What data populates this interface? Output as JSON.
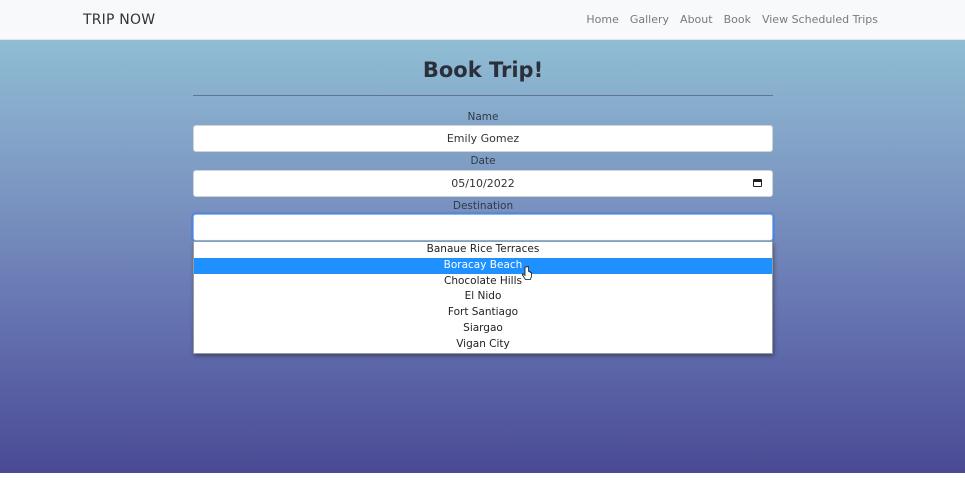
{
  "navbar": {
    "brand": "TRIP NOW",
    "links": [
      "Home",
      "Gallery",
      "About",
      "Book",
      "View Scheduled Trips"
    ]
  },
  "form": {
    "title": "Book Trip!",
    "name_label": "Name",
    "name_value": "Emily Gomez",
    "date_label": "Date",
    "date_value": "05/10/2022",
    "destination_label": "Destination",
    "destination_value": "",
    "destination_options": [
      "Banaue Rice Terraces",
      "Boracay Beach",
      "Chocolate Hills",
      "El Nido",
      "Fort Santiago",
      "Siargao",
      "Vigan City"
    ],
    "highlighted_option": "Boracay Beach"
  },
  "icons": {
    "date_picker": "calendar-icon",
    "pointer": "mouse-cursor-icon"
  },
  "colors": {
    "highlight": "#1e90ff",
    "gradient_top": "#8fbdd4",
    "gradient_bottom": "#4a4a94"
  }
}
